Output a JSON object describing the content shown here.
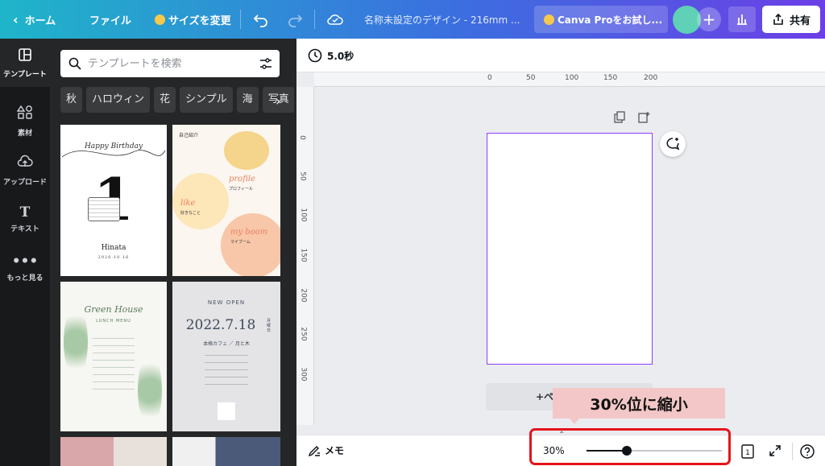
{
  "topbar": {
    "back_label": "ホーム",
    "file_label": "ファイル",
    "resize_label": "サイズを変更",
    "doc_title": "名称未設定のデザイン - 216mm ...",
    "pro_label": "Canva Proをお試し...",
    "share_label": "共有"
  },
  "rail": {
    "items": [
      {
        "label": "テンプレート",
        "icon": "template-icon"
      },
      {
        "label": "素材",
        "icon": "elements-icon"
      },
      {
        "label": "アップロード",
        "icon": "upload-icon"
      },
      {
        "label": "テキスト",
        "icon": "text-icon"
      },
      {
        "label": "もっと見る",
        "icon": "more-icon"
      }
    ]
  },
  "panel": {
    "search_placeholder": "テンプレートを検索",
    "chips": [
      "秋",
      "ハロウィン",
      "花",
      "シンプル",
      "海",
      "写真"
    ],
    "templates": [
      {
        "script": "Happy Birthday",
        "number": "1",
        "name": "Hinata",
        "date": "2020.10.16"
      },
      {
        "tag": "自己紹介",
        "profile": "profile",
        "profile_jp": "プロフィール",
        "like": "like",
        "like_jp": "好きなこと",
        "boom": "my boom",
        "boom_jp": "マイブーム"
      },
      {
        "title": "Green House",
        "subtitle": "LUNCH MENU"
      },
      {
        "label": "NEW OPEN",
        "date": "2022.7.18",
        "weekday": "月曜日",
        "sub": "本格カフェ ／ 月と木"
      }
    ]
  },
  "editor": {
    "timer": "5.0秒",
    "ruler_h": [
      "0",
      "50",
      "100",
      "150",
      "200"
    ],
    "ruler_v": [
      "0",
      "50",
      "100",
      "150",
      "200",
      "250",
      "300"
    ],
    "add_page_label": "+ペ"
  },
  "callout": {
    "text": "30%位に縮小"
  },
  "bottom": {
    "memo_label": "メモ",
    "zoom": "30%",
    "zoom_fraction": 0.3,
    "page_count": "1"
  }
}
